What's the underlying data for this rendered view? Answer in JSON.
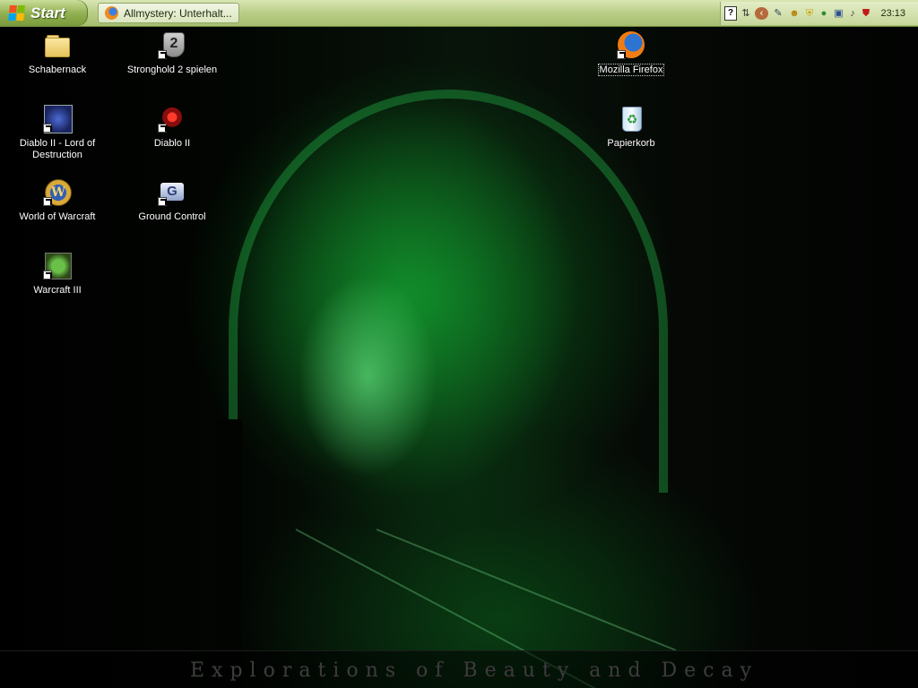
{
  "taskbar": {
    "start_label": "Start",
    "tasks": [
      {
        "label": "Allmystery: Unterhalt...",
        "icon": "firefox-icon"
      }
    ],
    "tray": {
      "icons": [
        "help-icon",
        "network-status-icon",
        "show-hidden-icons-icon",
        "usb-device-icon",
        "messenger-icon",
        "security-shield-icon",
        "user-icon",
        "monitor-icon",
        "volume-icon",
        "antivirus-icon"
      ],
      "clock": "23:13"
    }
  },
  "desktop": {
    "icons": [
      {
        "label": "Schabernack",
        "icon": "folder-icon"
      },
      {
        "label": "Stronghold 2 spielen",
        "icon": "stronghold-2-icon"
      },
      {
        "label": "Mozilla Firefox",
        "icon": "firefox-icon"
      },
      {
        "label": "Diablo II - Lord of Destruction",
        "icon": "diablo-2-lod-icon"
      },
      {
        "label": "Diablo II",
        "icon": "diablo-2-icon"
      },
      {
        "label": "Papierkorb",
        "icon": "recycle-bin-icon"
      },
      {
        "label": "World of Warcraft",
        "icon": "world-of-warcraft-icon"
      },
      {
        "label": "Ground Control",
        "icon": "ground-control-icon"
      },
      {
        "label": "Warcraft III",
        "icon": "warcraft-3-icon"
      }
    ]
  },
  "wallpaper": {
    "caption": "Explorations of Beauty and Decay",
    "colors": {
      "glow": "#29c850",
      "dark": "#000000"
    }
  }
}
